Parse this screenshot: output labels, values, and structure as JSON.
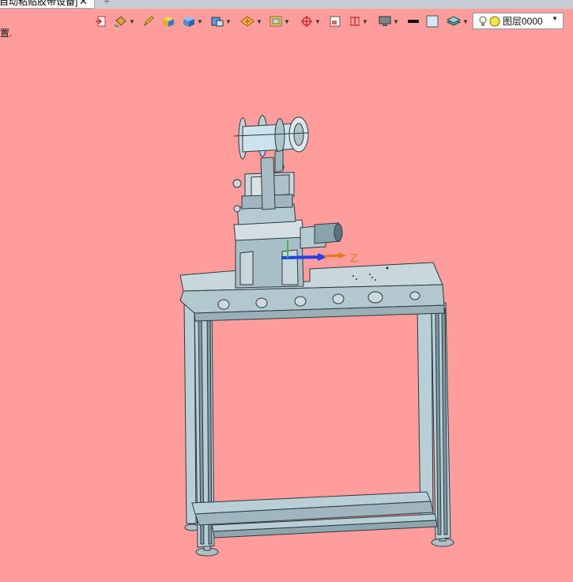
{
  "tab": {
    "title": "自动粘贴胶带设备]",
    "close": "✕",
    "add": "+"
  },
  "hint_text": "置.",
  "toolbar": {
    "items": [
      {
        "name": "exit-icon",
        "dropdown": false
      },
      {
        "name": "paint-bucket-icon",
        "dropdown": true
      },
      {
        "name": "pencil-icon",
        "dropdown": false
      },
      {
        "name": "box-yellow-icon",
        "dropdown": false
      },
      {
        "name": "box-blue-icon",
        "dropdown": true
      },
      {
        "name": "view-cube-icon",
        "dropdown": true
      },
      {
        "name": "section-icon",
        "dropdown": true
      },
      {
        "name": "frame-icon",
        "dropdown": true
      },
      {
        "name": "crosshair-icon",
        "dropdown": true
      },
      {
        "name": "zoom-window-icon",
        "dropdown": false
      },
      {
        "name": "measure-icon",
        "dropdown": true
      },
      {
        "name": "monitor-icon",
        "dropdown": true
      },
      {
        "name": "line-color-icon",
        "dropdown": false
      },
      {
        "name": "fill-color-icon",
        "dropdown": false
      },
      {
        "name": "layers-icon",
        "dropdown": true
      }
    ],
    "layer_value": "图层0000"
  },
  "triad": {
    "z_label": "Z"
  },
  "colors": {
    "background": "#fe9d9c",
    "frame": "#b8cfd6",
    "frame_dark": "#5d7480",
    "edge": "#2c3a40",
    "triad_blue": "#2340e6",
    "triad_orange": "#e07a1e"
  }
}
